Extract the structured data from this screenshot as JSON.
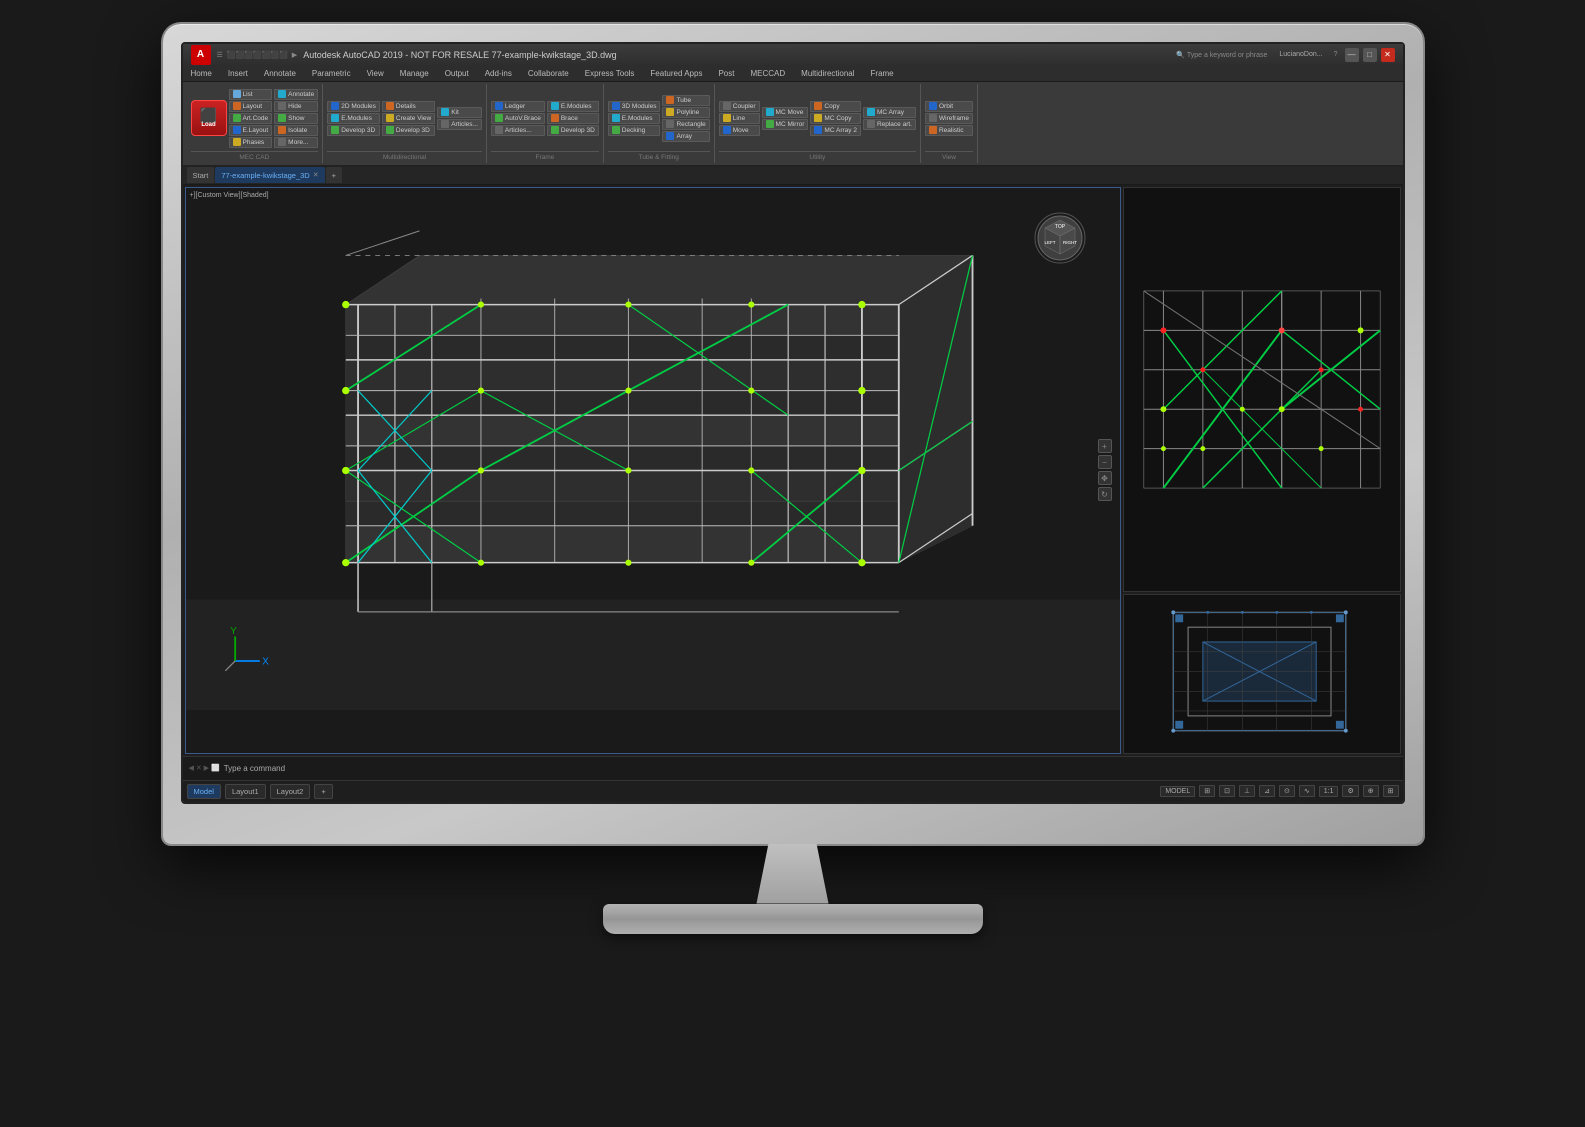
{
  "monitor": {
    "title": "Autodesk AutoCAD 2019 - NOT FOR RESALE  77-example-kwikstage_3D.dwg",
    "logo": "A",
    "user": "LucianoDon..."
  },
  "menu": {
    "items": [
      "Home",
      "Insert",
      "Annotate",
      "Parametric",
      "View",
      "Manage",
      "Output",
      "Add-ins",
      "Collaborate",
      "Express Tools",
      "Featured Apps",
      "Post",
      "MECCAD",
      "Multidirectional",
      "Frame"
    ]
  },
  "ribbon": {
    "tabs": [
      "Home",
      "Insert",
      "Annotate",
      "Parametric",
      "View",
      "Manage",
      "Output",
      "Add-ins",
      "Collaborate",
      "Express Tools",
      "Featured Apps",
      "Post",
      "MECCAD",
      "Multidirectional",
      "Frame"
    ],
    "active_tab": "Home",
    "groups": {
      "mec_cad": {
        "label": "MEC CAD",
        "buttons": [
          "Load",
          "List",
          "Layout",
          "Art.Code",
          "E.Layout",
          "Phases",
          "Annotate",
          "Hide",
          "Show",
          "Isolate",
          "More..."
        ]
      },
      "multidirectional": {
        "label": "Multidirectional",
        "buttons": [
          "2D Modules",
          "E.Modules",
          "Develop 3D",
          "Details",
          "Create View",
          "Develop 3D",
          "Kit",
          "Articles..."
        ]
      },
      "frame": {
        "label": "Frame",
        "buttons": [
          "Ledger",
          "AutoV.Brace",
          "Articles...",
          "E.Modules",
          "Brace",
          "Develop 3D"
        ]
      },
      "tube_fitting": {
        "label": "Tube & Fitting",
        "buttons": [
          "3D Modules",
          "E.Modules",
          "Decking",
          "Tube",
          "Polyline",
          "Rectangle",
          "Array"
        ]
      },
      "utility": {
        "label": "Utility",
        "buttons": [
          "Coupler",
          "Line",
          "Move",
          "MC Move",
          "MC Mirror",
          "Copy",
          "MC Copy",
          "MC Array 2",
          "MC Array",
          "Replace art."
        ]
      },
      "view": {
        "label": "View",
        "buttons": [
          "Orbit",
          "Wireframe",
          "Realistic"
        ]
      }
    }
  },
  "document": {
    "tabs": [
      "Start",
      "77-example-kwikstage_3D",
      "+"
    ],
    "active_tab": "77-example-kwikstage_3D"
  },
  "viewport": {
    "label": "+][Custom View][Shaded]",
    "nav_cube": {
      "right_label": "RIGHT"
    }
  },
  "status_bar": {
    "layout_tabs": [
      "Model",
      "Layout1",
      "Layout2",
      "+"
    ],
    "active": "Model",
    "right_items": [
      "MODEL",
      "1:1"
    ],
    "command_hint": "Type a command"
  },
  "command": {
    "prompt": "Type a command",
    "value": ""
  },
  "copy_button": {
    "label": "Copy"
  }
}
